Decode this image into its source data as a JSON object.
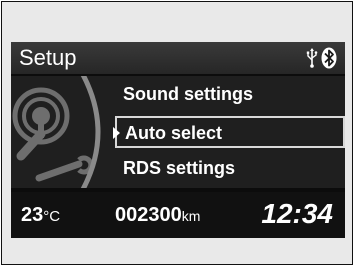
{
  "header": {
    "title": "Setup",
    "icons": [
      "usb-icon",
      "bluetooth-icon"
    ]
  },
  "menu": {
    "items": [
      {
        "label": "Sound settings",
        "selected": false
      },
      {
        "label": "Auto select",
        "selected": true
      },
      {
        "label": "RDS settings",
        "selected": false
      }
    ],
    "side_icon": "wrench-gear-icon"
  },
  "status": {
    "temperature": "23",
    "temperature_unit": "°C",
    "odometer": "002300",
    "odometer_unit": "km",
    "time": "12:34"
  },
  "colors": {
    "screen_bg": "#0c0c0c",
    "header_bg": "#2e2e2e",
    "content_bg": "#1f1f1f",
    "text": "#ffffff",
    "frame": "#e9e9e9"
  }
}
